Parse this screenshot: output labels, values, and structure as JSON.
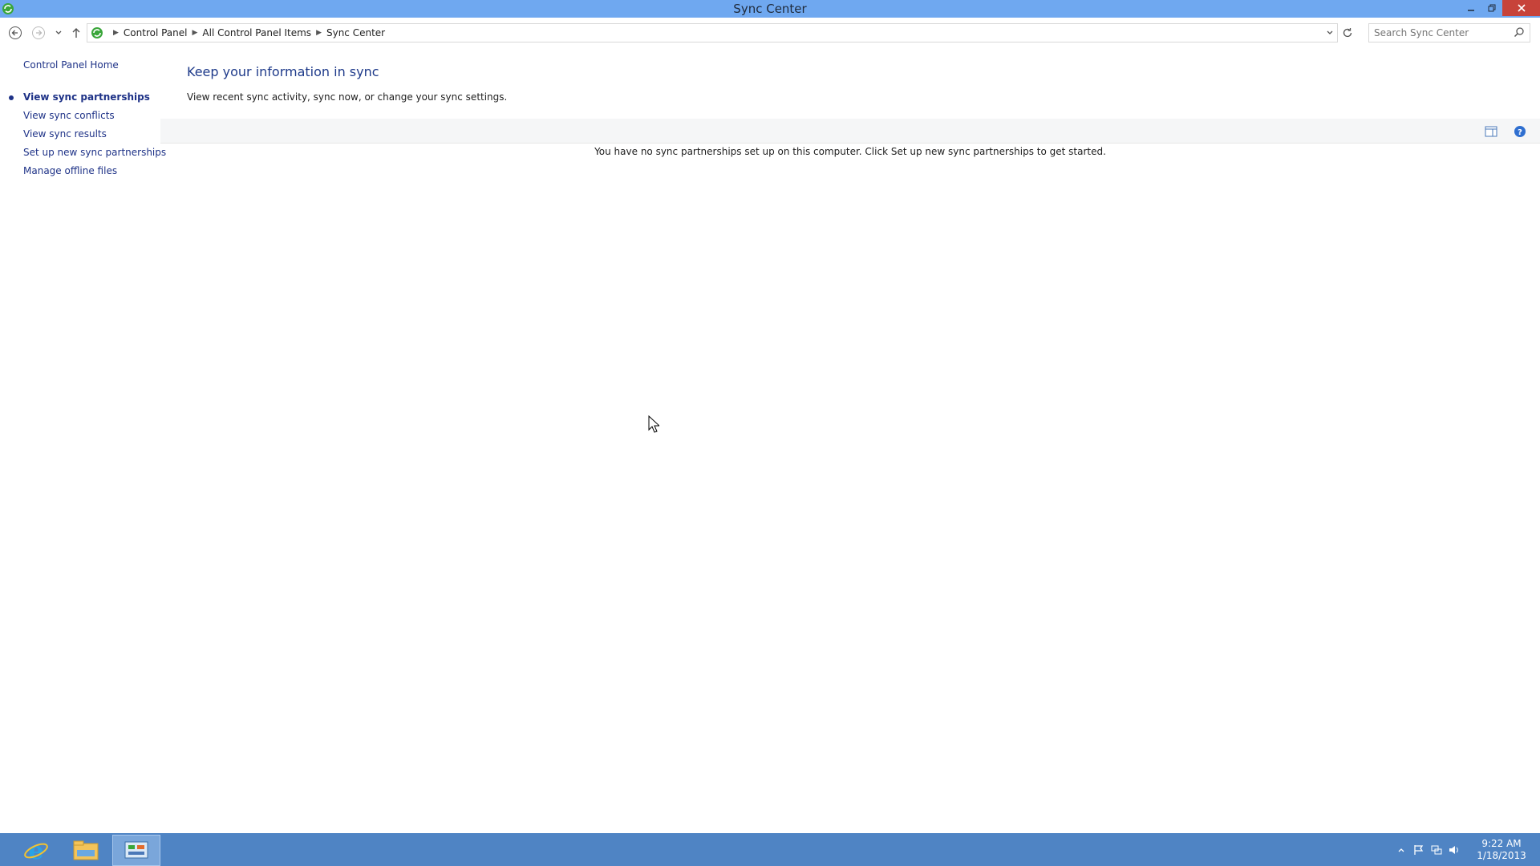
{
  "window": {
    "title": "Sync Center",
    "icon": "sync-center-icon"
  },
  "nav": {
    "breadcrumb": [
      "Control Panel",
      "All Control Panel Items",
      "Sync Center"
    ],
    "search_placeholder": "Search Sync Center"
  },
  "left_pane": {
    "home_link": "Control Panel Home",
    "tasks": [
      {
        "label": "View sync partnerships",
        "active": true
      },
      {
        "label": "View sync conflicts",
        "active": false
      },
      {
        "label": "View sync results",
        "active": false
      },
      {
        "label": "Set up new sync partnerships",
        "active": false
      },
      {
        "label": "Manage offline files",
        "active": false
      }
    ]
  },
  "main": {
    "heading": "Keep your information in sync",
    "subheading": "View recent sync activity, sync now, or change your sync settings.",
    "empty_message": "You have no sync partnerships set up on this computer. Click Set up new sync partnerships to get started."
  },
  "taskbar": {
    "apps": [
      "internet-explorer-icon",
      "file-explorer-icon",
      "control-panel-icon"
    ],
    "time": "9:22 AM",
    "date": "1/18/2013"
  },
  "colors": {
    "titlebar": "#6fa8f0",
    "taskbar": "#4f84c4",
    "link": "#1e3287",
    "close": "#c7433a"
  }
}
